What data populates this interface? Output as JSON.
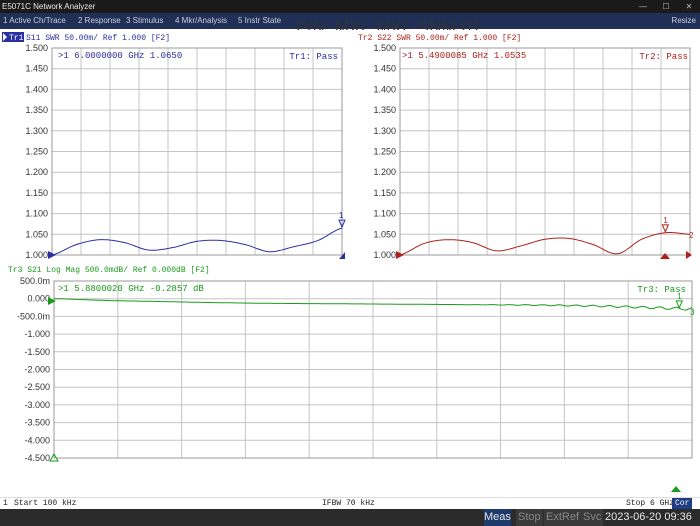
{
  "window": {
    "title": "E5071C Network Analyzer"
  },
  "menu": [
    "1 Active Ch/Trace",
    "2 Response",
    "3 Stimulus",
    "4 Mkr/Analysis",
    "5 Instr State"
  ],
  "menu_resize": "Resize",
  "header_text": "P/N: MXL-MXL-SNM-01",
  "colors": {
    "tr1": "#2b2fa0",
    "tr2": "#b0201a",
    "tr3": "#1a9a1a",
    "grid": "#c4c4c4",
    "menubar": "#1f2f55"
  },
  "tr1": {
    "badge": "Tr1",
    "header": "S11  SWR 50.00m/ Ref 1.000 [F2]",
    "marker": ">1   6.0000000 GHz  1.0650",
    "pass": "Tr1: Pass",
    "yticks": [
      "1.500",
      "1.450",
      "1.400",
      "1.350",
      "1.300",
      "1.250",
      "1.200",
      "1.150",
      "1.100",
      "1.050",
      "1.000"
    ],
    "marker_label": "1"
  },
  "tr2": {
    "header": "Tr2  S22  SWR 50.00m/ Ref 1.000 [F2]",
    "marker": ">1   5.4900085 GHz  1.0535",
    "pass": "Tr2: Pass",
    "yticks": [
      "1.500",
      "1.450",
      "1.400",
      "1.350",
      "1.300",
      "1.250",
      "1.200",
      "1.150",
      "1.100",
      "1.050",
      "1.000"
    ],
    "marker_label": "1",
    "marker_label2": "2"
  },
  "tr3": {
    "header": "Tr3  S21  Log Mag 500.0mdB/ Ref 0.000dB [F2]",
    "marker": ">1   5.8800020 GHz -0.2857 dB",
    "pass": "Tr3: Pass",
    "yticks": [
      "500.0m",
      "0.000",
      "-500.0m",
      "-1.000",
      "-1.500",
      "-2.000",
      "-2.500",
      "-3.000",
      "-3.500",
      "-4.000",
      "-4.500"
    ],
    "marker_label": "1",
    "marker_label2": "3"
  },
  "chart_data": [
    {
      "type": "line",
      "title": "S11 SWR",
      "x_range_hz": [
        100000,
        6000000000
      ],
      "ylim": [
        1.0,
        1.5
      ],
      "series": [
        {
          "name": "S11",
          "x_ghz": [
            0,
            0.5,
            1.0,
            1.5,
            2.0,
            2.5,
            3.0,
            3.5,
            4.0,
            4.5,
            5.0,
            5.5,
            6.0
          ],
          "values": [
            1.0,
            1.025,
            1.037,
            1.03,
            1.012,
            1.018,
            1.033,
            1.035,
            1.025,
            1.008,
            1.02,
            1.035,
            1.065
          ]
        }
      ]
    },
    {
      "type": "line",
      "title": "S22 SWR",
      "x_range_hz": [
        100000,
        6000000000
      ],
      "ylim": [
        1.0,
        1.5
      ],
      "series": [
        {
          "name": "S22",
          "x_ghz": [
            0,
            0.5,
            1.0,
            1.5,
            2.0,
            2.5,
            3.0,
            3.5,
            4.0,
            4.5,
            5.0,
            5.5,
            6.0
          ],
          "values": [
            1.0,
            1.028,
            1.037,
            1.03,
            1.01,
            1.022,
            1.038,
            1.04,
            1.025,
            1.003,
            1.038,
            1.054,
            1.05
          ]
        }
      ]
    },
    {
      "type": "line",
      "title": "S21 Log Mag",
      "x_range_hz": [
        100000,
        6000000000
      ],
      "ylim": [
        -4.5,
        0.5
      ],
      "series": [
        {
          "name": "S21",
          "x_ghz": [
            0,
            0.5,
            1.0,
            1.5,
            2.0,
            2.5,
            3.0,
            3.5,
            4.0,
            4.5,
            5.0,
            5.5,
            6.0
          ],
          "values": [
            0.0,
            -0.05,
            -0.08,
            -0.11,
            -0.13,
            -0.14,
            -0.15,
            -0.16,
            -0.17,
            -0.18,
            -0.2,
            -0.24,
            -0.29
          ]
        }
      ]
    }
  ],
  "status": {
    "channel": "1",
    "start": "Start 100 kHz",
    "ifbw": "IFBW 70 kHz",
    "stop": "Stop 6 GHz",
    "cor": "Cor"
  },
  "bottom": {
    "meas": "Meas",
    "stop": "Stop",
    "extref": "ExtRef",
    "svc": "Svc",
    "datetime": "2023-06-20 09:36"
  }
}
